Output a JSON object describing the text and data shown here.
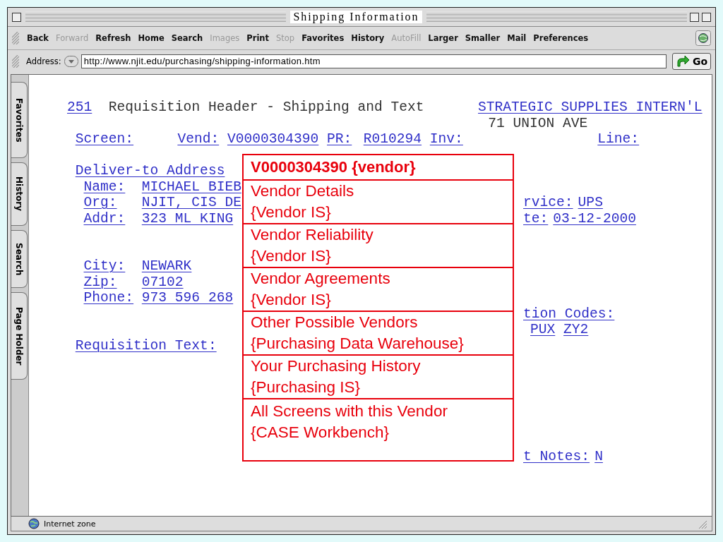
{
  "window": {
    "title": "Shipping Information"
  },
  "toolbar": [
    {
      "label": "Back",
      "disabled": false
    },
    {
      "label": "Forward",
      "disabled": true
    },
    {
      "label": "Refresh",
      "disabled": false
    },
    {
      "label": "Home",
      "disabled": false
    },
    {
      "label": "Search",
      "disabled": false
    },
    {
      "label": "Images",
      "disabled": true
    },
    {
      "label": "Print",
      "disabled": false
    },
    {
      "label": "Stop",
      "disabled": true
    },
    {
      "label": "Favorites",
      "disabled": false
    },
    {
      "label": "History",
      "disabled": false
    },
    {
      "label": "AutoFill",
      "disabled": true
    },
    {
      "label": "Larger",
      "disabled": false
    },
    {
      "label": "Smaller",
      "disabled": false
    },
    {
      "label": "Mail",
      "disabled": false
    },
    {
      "label": "Preferences",
      "disabled": false
    }
  ],
  "address_bar": {
    "label": "Address:",
    "url": "http://www.njit.edu/purchasing/shipping-information.htm",
    "go": "Go"
  },
  "sidebar_tabs": [
    "Favorites",
    "History",
    "Search",
    "Page Holder"
  ],
  "page": {
    "header": {
      "number": "251",
      "title": "Requisition Header - Shipping and Text",
      "vendor_name": "STRATEGIC SUPPLIES INTERN'L",
      "vendor_address": "71 UNION AVE"
    },
    "keys": {
      "screen": "Screen:",
      "vend_label": "Vend:",
      "vend": "V0000304390",
      "pr_label": "PR:",
      "pr": "R010294",
      "inv_label": "Inv:",
      "line_label": "Line:"
    },
    "deliver_heading": "Deliver-to Address",
    "address_fields": [
      {
        "label": "Name:",
        "value": "MICHAEL BIEB"
      },
      {
        "label": "Org:",
        "value": "NJIT, CIS DE"
      },
      {
        "label": "Addr:",
        "value": "323 ML KING"
      }
    ],
    "city_fields": [
      {
        "label": "City:",
        "value": "NEWARK"
      },
      {
        "label": "Zip:",
        "value": "07102"
      },
      {
        "label": "Phone:",
        "value": "973 596 268"
      }
    ],
    "service": {
      "label": "rvice:",
      "value": "UPS"
    },
    "date": {
      "label": "te:",
      "value": "03-12-2000"
    },
    "codes": {
      "label": "tion Codes:",
      "values": [
        "PUX",
        "ZY2"
      ]
    },
    "requisition_text": "Requisition Text:",
    "notes": {
      "label": "t Notes:",
      "value": "N"
    }
  },
  "popup": {
    "title": "V0000304390 {vendor}",
    "items": [
      {
        "name": "Vendor Details",
        "source": "{Vendor IS}"
      },
      {
        "name": "Vendor Reliability",
        "source": "{Vendor IS}"
      },
      {
        "name": "Vendor Agreements",
        "source": "{Vendor IS}"
      },
      {
        "name": "Other Possible Vendors",
        "source": "{Purchasing Data Warehouse}"
      },
      {
        "name": "Your Purchasing History",
        "source": "{Purchasing IS}"
      },
      {
        "name": "All Screens with this Vendor",
        "source": "{CASE Workbench}"
      }
    ]
  },
  "status_bar": {
    "zone": "Internet zone"
  }
}
